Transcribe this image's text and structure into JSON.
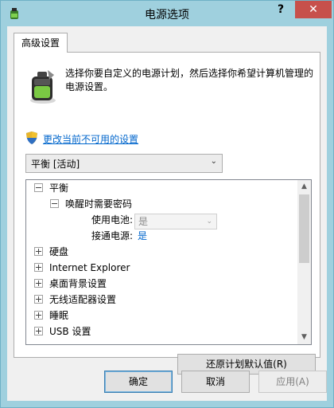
{
  "window": {
    "title": "电源选项",
    "help_glyph": "?",
    "close_glyph": "✕"
  },
  "tab": {
    "label": "高级设置"
  },
  "description": "选择你要自定义的电源计划，然后选择你希望计算机管理的电源设置。",
  "link": {
    "label": "更改当前不可用的设置"
  },
  "plan_select": {
    "value": "平衡 [活动]",
    "arrow": "⌄"
  },
  "tree": {
    "root_label": "平衡",
    "group_label": "唤醒时需要密码",
    "on_battery": {
      "label": "使用电池:",
      "value": "是"
    },
    "plugged_in": {
      "label": "接通电源:",
      "value": "是"
    },
    "items": [
      "硬盘",
      "Internet Explorer",
      "桌面背景设置",
      "无线适配器设置",
      "睡眠",
      "USB 设置"
    ],
    "scroll_up": "▲",
    "scroll_down": "▼"
  },
  "buttons": {
    "restore": "还原计划默认值(R)",
    "ok": "确定",
    "cancel": "取消",
    "apply": "应用(A)"
  },
  "colors": {
    "frame": "#9fd0de",
    "close": "#c7504b",
    "link": "#0066cc"
  }
}
